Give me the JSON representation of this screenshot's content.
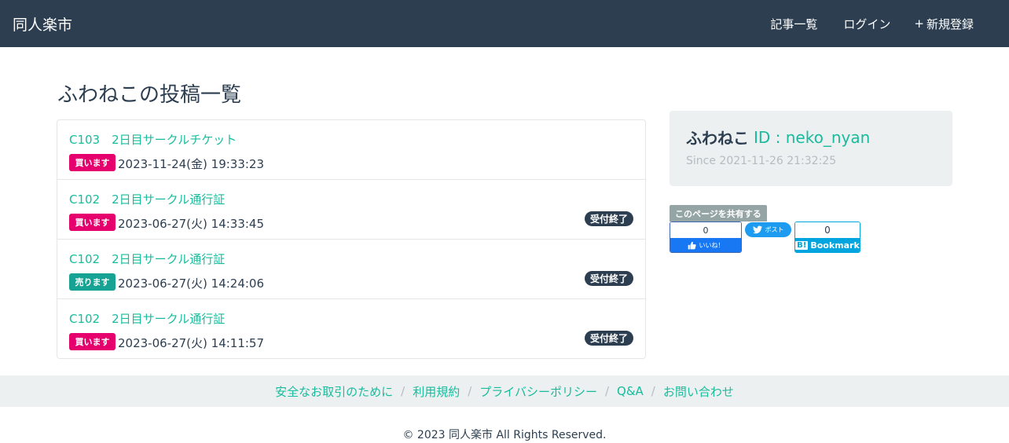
{
  "navbar": {
    "brand": "同人楽市",
    "links": [
      {
        "icon": "list-icon",
        "icon_glyph": "",
        "label": "記事一覧"
      },
      {
        "icon": "login-icon",
        "icon_glyph": "",
        "label": "ログイン"
      },
      {
        "icon": "plus-icon",
        "icon_glyph": "+",
        "label": "新規登録"
      }
    ]
  },
  "page_title": "ふわねこの投稿一覧",
  "posts": [
    {
      "title": "C103　2日目サークルチケット",
      "type_label": "買います",
      "type": "buy",
      "date": "2023-11-24(金) 19:33:23",
      "status": ""
    },
    {
      "title": "C102　2日目サークル通行証",
      "type_label": "買います",
      "type": "buy",
      "date": "2023-06-27(火) 14:33:45",
      "status": "受付終了"
    },
    {
      "title": "C102　2日目サークル通行証",
      "type_label": "売ります",
      "type": "sell",
      "date": "2023-06-27(火) 14:24:06",
      "status": "受付終了"
    },
    {
      "title": "C102　2日目サークル通行証",
      "type_label": "買います",
      "type": "buy",
      "date": "2023-06-27(火) 14:11:57",
      "status": "受付終了"
    }
  ],
  "profile": {
    "user_icon_glyph": "",
    "name": "ふわねこ",
    "id_text": "ID : neko_nyan",
    "clock_icon_glyph": "",
    "since": "Since 2021-11-26 21:32:25"
  },
  "share": {
    "label": "このページを共有する",
    "facebook_count": "0",
    "facebook_label": "いいね！",
    "twitter_label": "ポスト",
    "hatena_count": "0",
    "hatena_mark": "B!",
    "hatena_label": "Bookmark"
  },
  "footer": {
    "links": [
      "安全なお取引のために",
      "利用規約",
      "プライバシーポリシー",
      "Q&A",
      "お問い合わせ"
    ],
    "separator": "/",
    "copyright": "© 2023 同人楽市 All Rights Reserved."
  },
  "colors": {
    "navbar": "#2c3e50",
    "accent": "#18bc9c",
    "buy_badge": "#e6006e",
    "sell_badge": "#17a394",
    "status_badge": "#2c3e50",
    "panel_bg": "#ecf0f1"
  }
}
